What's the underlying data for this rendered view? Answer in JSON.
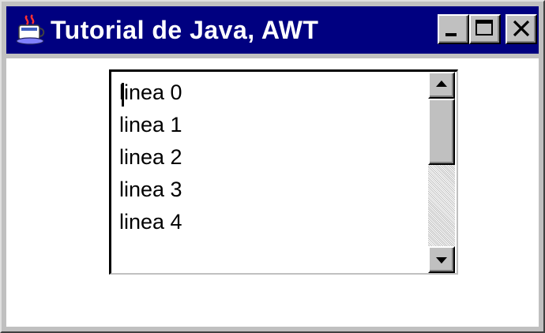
{
  "window": {
    "title": "Tutorial de Java, AWT"
  },
  "titlebar": {
    "app_icon": "java-coffee-icon",
    "buttons": [
      {
        "name": "minimize",
        "icon": "minimize-icon"
      },
      {
        "name": "maximize",
        "icon": "maximize-icon"
      },
      {
        "name": "close",
        "icon": "close-icon"
      }
    ]
  },
  "list": {
    "items": [
      "linea 0",
      "linea 1",
      "linea 2",
      "linea 3",
      "linea 4"
    ],
    "focused_index": 0
  },
  "scrollbar": {
    "up_icon": "arrow-up-icon",
    "down_icon": "arrow-down-icon"
  },
  "colors": {
    "titlebar": "#000080",
    "face": "#c0c0c0",
    "list_background": "#ffffff"
  }
}
